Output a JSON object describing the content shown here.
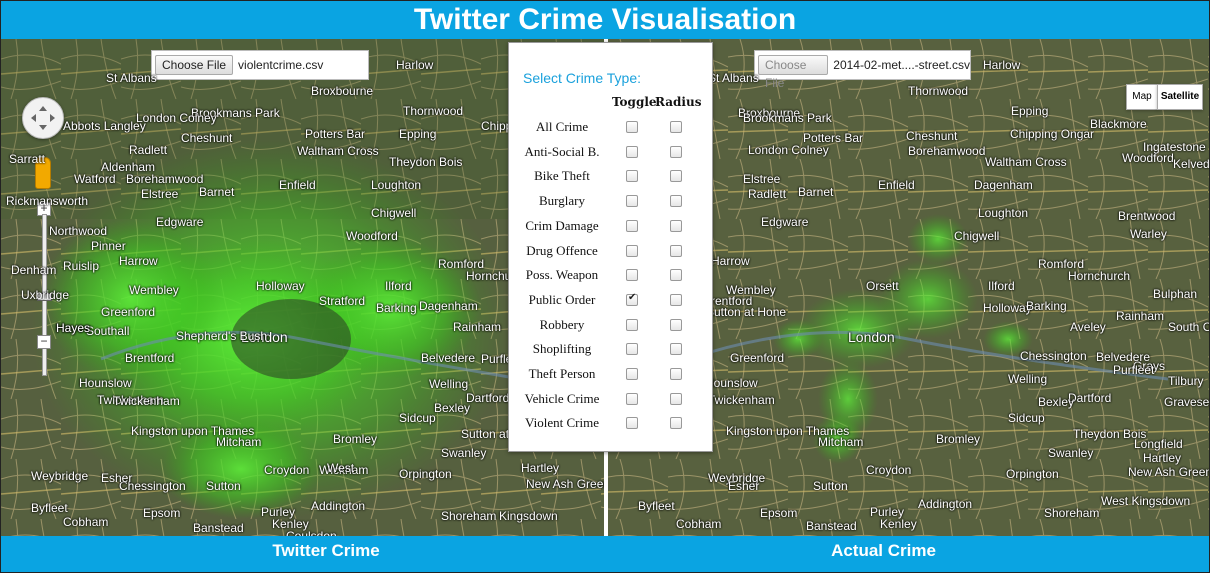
{
  "header": {
    "title": "Twitter Crime Visualisation"
  },
  "left_map": {
    "file_button": "Choose File",
    "file_name": "violentcrime.csv",
    "caption": "Twitter Crime",
    "places": [
      "St Albans",
      "Harlow",
      "Watford",
      "Enfield",
      "Edgware",
      "Harrow",
      "Wembley",
      "London",
      "Romford",
      "Ilford",
      "Hounslow",
      "Twickenham",
      "Mitcham",
      "Croydon",
      "Sutton",
      "Bromley",
      "Epsom",
      "Kingston upon Thames",
      "Barnet",
      "Cheshunt",
      "Potters Bar",
      "Northwood",
      "Greenford",
      "Brentford",
      "Belvedere",
      "Welling",
      "Bexley",
      "Dartford",
      "Sidcup",
      "Orpington",
      "Chessington",
      "Banstead",
      "Cobham",
      "Weybridge",
      "Esher",
      "Loughton",
      "Chigwell",
      "Woodford",
      "Southall",
      "Hayes",
      "Ruislip",
      "Pinner",
      "Borehamwood",
      "Radlett",
      "Elstree",
      "Rickmansworth",
      "Uxbridge",
      "Brookmans Park",
      "London Colney",
      "Theydon Bois",
      "Broxbourne",
      "Thornwood",
      "Epping",
      "Waltham Cross",
      "Holloway",
      "Barking",
      "Dagenham",
      "Rainham",
      "Purfleet",
      "Swanley",
      "Hartley",
      "Kingsdown",
      "Shoreham",
      "Addington",
      "Purley",
      "Kenley",
      "Coulsdon",
      "Wickham",
      "West",
      "Sutton at Hone",
      "New Ash Green",
      "Byfleet",
      "Aldenham",
      "Chipping",
      "Twickenham",
      "Shepherd's Bush",
      "Stratford",
      "Hornchurch",
      "Abbots Langley",
      "Sarratt",
      "Denham",
      "Hayes"
    ]
  },
  "right_map": {
    "file_button": "Choose File",
    "file_name": "2014-02-met....-street.csv",
    "caption": "Actual Crime",
    "map_type_buttons": [
      "Map",
      "Satellite"
    ],
    "places": [
      "St Albans",
      "Harlow",
      "Enfield",
      "Barnet",
      "Edgware",
      "Harrow",
      "Wembley",
      "London",
      "Romford",
      "Ilford",
      "Hounslow",
      "Twickenham",
      "Mitcham",
      "Croydon",
      "Sutton",
      "Bromley",
      "Epsom",
      "Kingston upon Thames",
      "Cheshunt",
      "Potters Bar",
      "Brentwood",
      "Warley",
      "Hornchurch",
      "Bulphan",
      "Grays",
      "Tilbury",
      "Gravesend",
      "Dartford",
      "Bexley",
      "Welling",
      "Sidcup",
      "Orpington",
      "Swanley",
      "Longfield",
      "Hartley",
      "New Ash Green",
      "West Kingsdown",
      "Shoreham",
      "Addington",
      "Purley",
      "Kenley",
      "Banstead",
      "Cobham",
      "Byfleet",
      "Weybridge",
      "Esher",
      "Chessington",
      "Belvedere",
      "Purfleet",
      "Aveley",
      "Rainham",
      "South Ockendon",
      "Orsett",
      "Holloway",
      "Barking",
      "Dagenham",
      "Loughton",
      "Chigwell",
      "Woodford",
      "Kelvedon Hatch",
      "Ingatestone",
      "Blackmore",
      "Chipping Ongar",
      "Epping",
      "Thornwood",
      "Broxbourne",
      "Brookmans Park",
      "London Colney",
      "Radlett",
      "Elstree",
      "Borehamwood",
      "Waltham Cross",
      "Theydon Bois",
      "Sutton at Hone",
      "Greenford",
      "Brentford"
    ]
  },
  "crime_panel": {
    "title": "Select Crime Type:",
    "col_toggle": "Toggle",
    "col_radius": "Radius",
    "rows": [
      {
        "label": "All Crime",
        "toggle": false,
        "radius": false
      },
      {
        "label": "Anti-Social B.",
        "toggle": false,
        "radius": false
      },
      {
        "label": "Bike Theft",
        "toggle": false,
        "radius": false
      },
      {
        "label": "Burglary",
        "toggle": false,
        "radius": false
      },
      {
        "label": "Crim Damage",
        "toggle": false,
        "radius": false
      },
      {
        "label": "Drug Offence",
        "toggle": false,
        "radius": false
      },
      {
        "label": "Poss. Weapon",
        "toggle": false,
        "radius": false
      },
      {
        "label": "Public Order",
        "toggle": true,
        "radius": false
      },
      {
        "label": "Robbery",
        "toggle": false,
        "radius": false
      },
      {
        "label": "Shoplifting",
        "toggle": false,
        "radius": false
      },
      {
        "label": "Theft Person",
        "toggle": false,
        "radius": false
      },
      {
        "label": "Vehicle Crime",
        "toggle": false,
        "radius": false
      },
      {
        "label": "Violent Crime",
        "toggle": false,
        "radius": false
      }
    ]
  },
  "map_controls": {
    "zoom_in": "+",
    "zoom_out": "−",
    "icons": [
      "pan-control-icon",
      "pegman-icon",
      "zoom-slider-icon"
    ]
  },
  "colors": {
    "header_bg": "#0aa4e2",
    "heat": "#5ff03a",
    "panel_title": "#1aa1dc"
  }
}
